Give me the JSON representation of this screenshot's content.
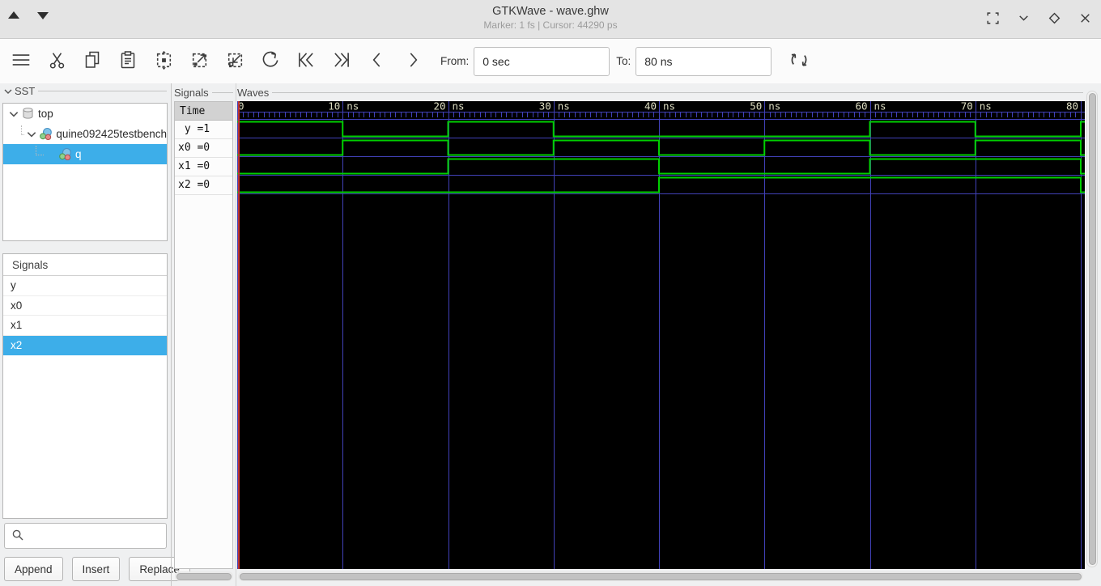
{
  "window": {
    "title": "GTKWave - wave.ghw",
    "subtitle": "Marker: 1 fs  |  Cursor: 44290 ps",
    "controls": [
      "fullscreen",
      "minimize",
      "maximize",
      "close"
    ]
  },
  "toolbar": {
    "icons": [
      "menu",
      "cut",
      "copy",
      "paste",
      "zoom-fit",
      "zoom-in",
      "zoom-out",
      "undo",
      "skip-to-start",
      "skip-to-end",
      "step-back",
      "step-forward"
    ],
    "from_label": "From:",
    "from_value": "0 sec",
    "to_label": "To:",
    "to_value": "80 ns",
    "reload_icon": "reload"
  },
  "sst": {
    "label": "SST",
    "tree": [
      {
        "label": "top",
        "icon": "cylinder",
        "depth": 0,
        "expanded": true,
        "selected": false
      },
      {
        "label": "quine092425testbench",
        "icon": "module",
        "depth": 1,
        "expanded": true,
        "selected": false
      },
      {
        "label": "q",
        "icon": "module",
        "depth": 2,
        "expanded": null,
        "selected": true
      }
    ]
  },
  "signals_panel": {
    "label": "Signals",
    "items": [
      {
        "label": "y",
        "selected": false
      },
      {
        "label": "x0",
        "selected": false
      },
      {
        "label": "x1",
        "selected": false
      },
      {
        "label": "x2",
        "selected": true
      }
    ],
    "search_placeholder": "",
    "buttons": [
      "Append",
      "Insert",
      "Replace"
    ]
  },
  "wave_names": {
    "label": "Signals",
    "header": "Time",
    "rows": [
      " y =1",
      "x0 =0",
      "x1 =0",
      "x2 =0"
    ]
  },
  "waves": {
    "label": "Waves"
  },
  "chart_data": {
    "type": "digital-waveform",
    "time_unit": "ns",
    "t_start": 0,
    "t_end": 80,
    "step_ns": 10,
    "timeline_labels": [
      "0",
      "10 ns",
      "20 ns",
      "30 ns",
      "40 ns",
      "50 ns",
      "60 ns",
      "70 ns",
      "80 ns"
    ],
    "grid_every_ns": 10,
    "tick_every_ns": 0.5,
    "marker_time": "1 fs",
    "cursor_time": "44290 ps",
    "signals": [
      {
        "name": "y",
        "value_at_marker": 1,
        "levels": [
          1,
          0,
          1,
          0,
          0,
          0,
          1,
          0
        ],
        "end_level": 1
      },
      {
        "name": "x0",
        "value_at_marker": 0,
        "levels": [
          0,
          1,
          0,
          1,
          0,
          1,
          0,
          1
        ],
        "end_level": 0
      },
      {
        "name": "x1",
        "value_at_marker": 0,
        "levels": [
          0,
          0,
          1,
          1,
          0,
          0,
          1,
          1
        ],
        "end_level": 0
      },
      {
        "name": "x2",
        "value_at_marker": 0,
        "levels": [
          0,
          0,
          0,
          0,
          1,
          1,
          1,
          1
        ],
        "end_level": 0
      }
    ],
    "colors": {
      "trace": "#00d000",
      "grid": "#4141b8",
      "background": "#000000",
      "marker": "#c03232",
      "time_text": "#dcdcc0"
    }
  }
}
